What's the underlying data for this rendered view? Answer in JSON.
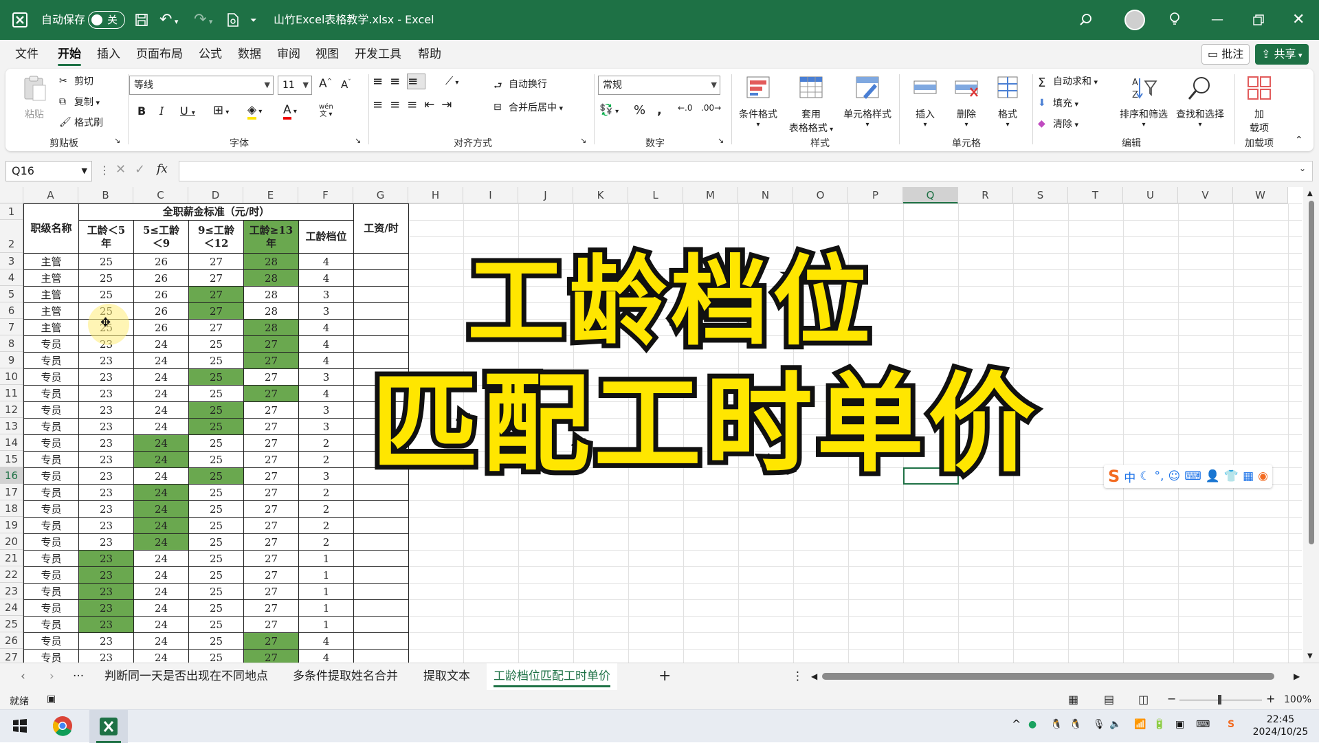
{
  "titlebar": {
    "autosave_label": "自动保存",
    "autosave_state": "关",
    "filename": "山竹Excel表格教学.xlsx",
    "app": "Excel",
    "separator": " - "
  },
  "menu": [
    "文件",
    "开始",
    "插入",
    "页面布局",
    "公式",
    "数据",
    "审阅",
    "视图",
    "开发工具",
    "帮助"
  ],
  "menu_right": {
    "comments": "批注",
    "share": "共享"
  },
  "ribbon": {
    "clipboard": {
      "paste": "粘贴",
      "cut": "剪切",
      "copy": "复制",
      "format_painter": "格式刷",
      "label": "剪贴板"
    },
    "font": {
      "name": "等线",
      "size": "11",
      "label": "字体",
      "wen": "wén"
    },
    "alignment": {
      "wrap": "自动换行",
      "merge": "合并后居中",
      "label": "对齐方式"
    },
    "number": {
      "format": "常规",
      "label": "数字"
    },
    "styles": {
      "conditional": "条件格式",
      "table_1": "套用",
      "table_2": "表格格式",
      "cell_styles": "单元格样式",
      "label": "样式"
    },
    "cells": {
      "insert": "插入",
      "delete": "删除",
      "format": "格式",
      "label": "单元格"
    },
    "editing": {
      "autosum": "自动求和",
      "fill": "填充",
      "clear": "清除",
      "sort": "排序和筛选",
      "find": "查找和选择",
      "label": "编辑"
    },
    "addins": {
      "btn_1": "加",
      "btn_2": "载项",
      "label": "加载项"
    }
  },
  "formula_bar": {
    "name_box": "Q16",
    "fx": "fx",
    "content": ""
  },
  "columns": [
    "A",
    "B",
    "C",
    "D",
    "E",
    "F",
    "G",
    "H",
    "I",
    "J",
    "K",
    "L",
    "M",
    "N",
    "O",
    "P",
    "Q",
    "R",
    "S",
    "T",
    "U",
    "V",
    "W"
  ],
  "selected_column": "Q",
  "selected_row": 16,
  "table": {
    "merged_title": "全职薪金标准（元/时）",
    "headers": [
      "职级名称",
      "工龄＜5年",
      "5≤工龄＜9",
      "9≤工龄＜12",
      "工龄≥13年",
      "工龄档位",
      "工资/时"
    ],
    "rows": [
      {
        "r": 3,
        "name": "主管",
        "b": 25,
        "c": 26,
        "d": 27,
        "e": 28,
        "f": 4,
        "hl": "e"
      },
      {
        "r": 4,
        "name": "主管",
        "b": 25,
        "c": 26,
        "d": 27,
        "e": 28,
        "f": 4,
        "hl": "e"
      },
      {
        "r": 5,
        "name": "主管",
        "b": 25,
        "c": 26,
        "d": 27,
        "e": 28,
        "f": 3,
        "hl": "d"
      },
      {
        "r": 6,
        "name": "主管",
        "b": 25,
        "c": 26,
        "d": 27,
        "e": 28,
        "f": 3,
        "hl": "d"
      },
      {
        "r": 7,
        "name": "主管",
        "b": 25,
        "c": 26,
        "d": 27,
        "e": 28,
        "f": 4,
        "hl": "e"
      },
      {
        "r": 8,
        "name": "专员",
        "b": 23,
        "c": 24,
        "d": 25,
        "e": 27,
        "f": 4,
        "hl": "e"
      },
      {
        "r": 9,
        "name": "专员",
        "b": 23,
        "c": 24,
        "d": 25,
        "e": 27,
        "f": 4,
        "hl": "e"
      },
      {
        "r": 10,
        "name": "专员",
        "b": 23,
        "c": 24,
        "d": 25,
        "e": 27,
        "f": 3,
        "hl": "d"
      },
      {
        "r": 11,
        "name": "专员",
        "b": 23,
        "c": 24,
        "d": 25,
        "e": 27,
        "f": 4,
        "hl": "e"
      },
      {
        "r": 12,
        "name": "专员",
        "b": 23,
        "c": 24,
        "d": 25,
        "e": 27,
        "f": 3,
        "hl": "d"
      },
      {
        "r": 13,
        "name": "专员",
        "b": 23,
        "c": 24,
        "d": 25,
        "e": 27,
        "f": 3,
        "hl": "d"
      },
      {
        "r": 14,
        "name": "专员",
        "b": 23,
        "c": 24,
        "d": 25,
        "e": 27,
        "f": 2,
        "hl": "c"
      },
      {
        "r": 15,
        "name": "专员",
        "b": 23,
        "c": 24,
        "d": 25,
        "e": 27,
        "f": 2,
        "hl": "c"
      },
      {
        "r": 16,
        "name": "专员",
        "b": 23,
        "c": 24,
        "d": 25,
        "e": 27,
        "f": 3,
        "hl": "d"
      },
      {
        "r": 17,
        "name": "专员",
        "b": 23,
        "c": 24,
        "d": 25,
        "e": 27,
        "f": 2,
        "hl": "c"
      },
      {
        "r": 18,
        "name": "专员",
        "b": 23,
        "c": 24,
        "d": 25,
        "e": 27,
        "f": 2,
        "hl": "c"
      },
      {
        "r": 19,
        "name": "专员",
        "b": 23,
        "c": 24,
        "d": 25,
        "e": 27,
        "f": 2,
        "hl": "c"
      },
      {
        "r": 20,
        "name": "专员",
        "b": 23,
        "c": 24,
        "d": 25,
        "e": 27,
        "f": 2,
        "hl": "c"
      },
      {
        "r": 21,
        "name": "专员",
        "b": 23,
        "c": 24,
        "d": 25,
        "e": 27,
        "f": 1,
        "hl": "b"
      },
      {
        "r": 22,
        "name": "专员",
        "b": 23,
        "c": 24,
        "d": 25,
        "e": 27,
        "f": 1,
        "hl": "b"
      },
      {
        "r": 23,
        "name": "专员",
        "b": 23,
        "c": 24,
        "d": 25,
        "e": 27,
        "f": 1,
        "hl": "b"
      },
      {
        "r": 24,
        "name": "专员",
        "b": 23,
        "c": 24,
        "d": 25,
        "e": 27,
        "f": 1,
        "hl": "b"
      },
      {
        "r": 25,
        "name": "专员",
        "b": 23,
        "c": 24,
        "d": 25,
        "e": 27,
        "f": 1,
        "hl": "b"
      },
      {
        "r": 26,
        "name": "专员",
        "b": 23,
        "c": 24,
        "d": 25,
        "e": 27,
        "f": 4,
        "hl": "e"
      },
      {
        "r": 27,
        "name": "专员",
        "b": 23,
        "c": 24,
        "d": 25,
        "e": 27,
        "f": 4,
        "hl": "e"
      }
    ]
  },
  "overlay": {
    "line1": "工龄档位",
    "line2": "匹配工时单价"
  },
  "sheets": [
    "判断同一天是否出现在不同地点",
    "多条件提取姓名合并",
    "提取文本",
    "工龄档位匹配工时单价"
  ],
  "active_sheet": "工龄档位匹配工时单价",
  "status": {
    "ready": "就绪",
    "zoom": "100%"
  },
  "ime": {
    "lang": "中"
  },
  "taskbar": {
    "time": "22:45",
    "date": "2024/10/25"
  },
  "colors": {
    "accent": "#1e7145",
    "highlight": "#6aa84f",
    "overlay_fill": "#ffe600"
  }
}
